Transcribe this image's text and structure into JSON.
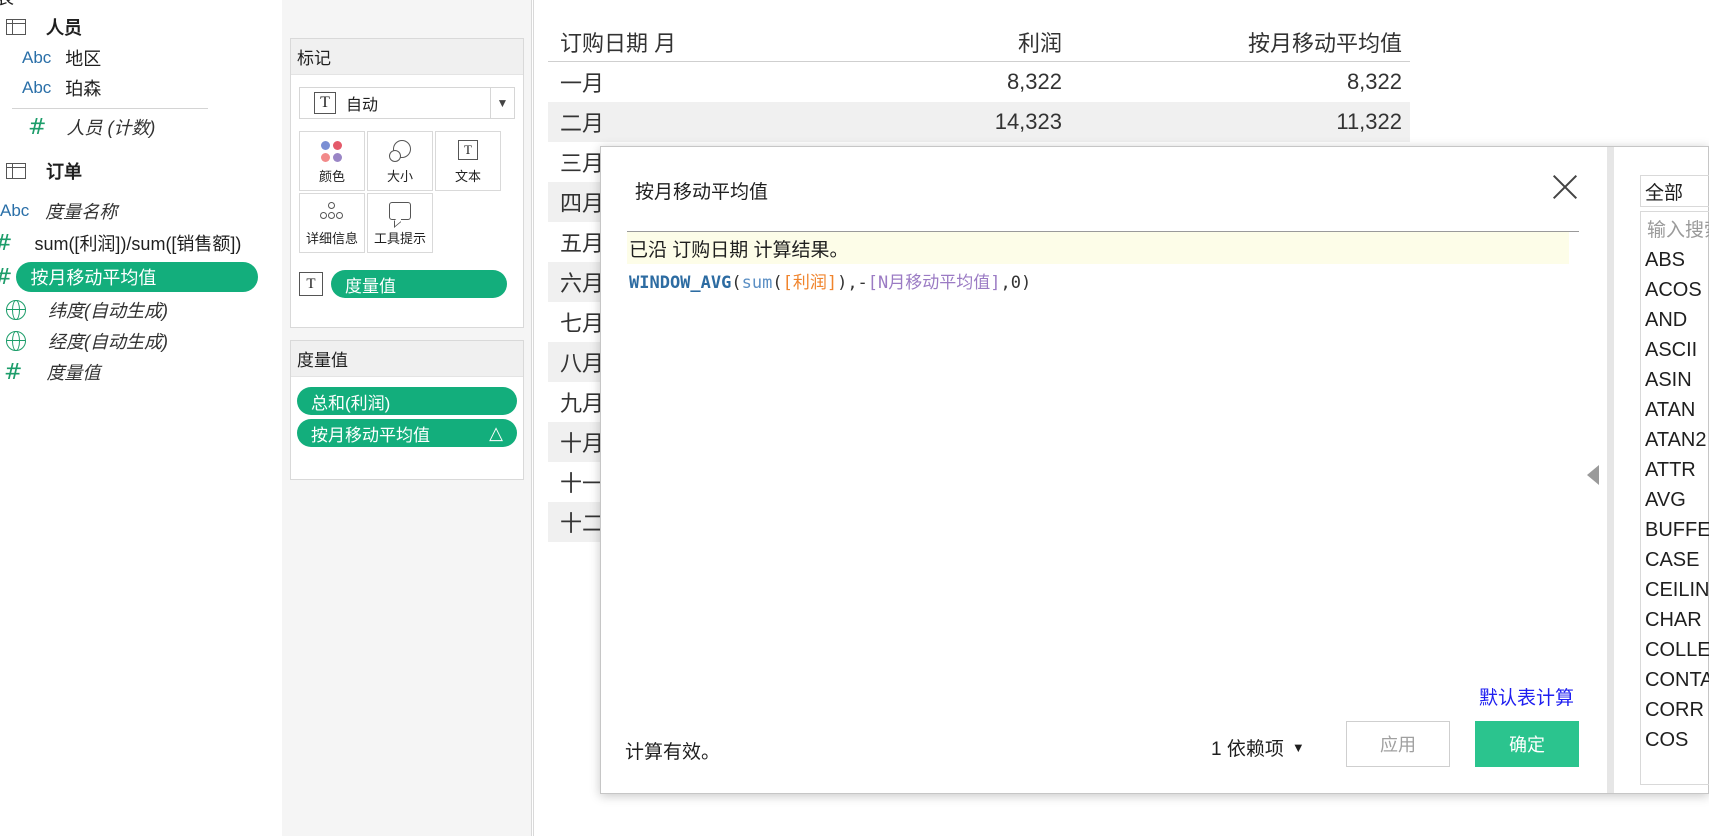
{
  "data_pane": {
    "top_partial": "表",
    "group_people": "人员",
    "field_region": "地区",
    "field_person": "珀森",
    "field_people_count": "人员 (计数)",
    "group_orders": "订单",
    "field_measure_names": "度量名称",
    "field_profit_ratio": "sum([利润])/sum([销售额])",
    "field_moving_avg": "按月移动平均值",
    "field_latitude": "纬度(自动生成)",
    "field_longitude": "经度(自动生成)",
    "field_measure_values": "度量值",
    "abc_label": "Abc",
    "hash_symbol": "#"
  },
  "marks": {
    "title": "标记",
    "type_value": "自动",
    "t_glyph": "T",
    "buttons": {
      "color": "颜色",
      "size": "大小",
      "text": "文本",
      "detail": "详细信息",
      "tooltip": "工具提示"
    },
    "text_pill": "度量值"
  },
  "measure_values_card": {
    "title": "度量值",
    "pills": [
      "总和(利润)",
      "按月移动平均值"
    ],
    "delta_symbol": "△"
  },
  "view_table": {
    "headers": [
      "订购日期 月",
      "利润",
      "按月移动平均值"
    ],
    "rows": [
      [
        "一月",
        "8,322",
        "8,322"
      ],
      [
        "二月",
        "14,323",
        "11,322"
      ],
      [
        "三月",
        "",
        ""
      ],
      [
        "四月",
        "",
        ""
      ],
      [
        "五月",
        "",
        ""
      ],
      [
        "六月",
        "",
        ""
      ],
      [
        "七月",
        "",
        ""
      ],
      [
        "八月",
        "",
        ""
      ],
      [
        "九月",
        "",
        ""
      ],
      [
        "十月",
        "",
        ""
      ],
      [
        "十一",
        "",
        ""
      ],
      [
        "十二",
        "",
        ""
      ]
    ]
  },
  "calc_dialog": {
    "title": "按月移动平均值",
    "note": "已沿 订购日期 计算结果。",
    "formula": {
      "fn": "WINDOW_AVG",
      "open": "(",
      "agg": "sum",
      "agg_open": "(",
      "field": "[利润]",
      "agg_close": ")",
      "comma1": ",-",
      "param": "[N月移动平均值]",
      "comma2": ",0",
      "close": ")"
    },
    "default_table_calc": "默认表计算",
    "status": "计算有效。",
    "dependencies": "1 依赖项",
    "apply": "应用",
    "ok": "确定"
  },
  "functions": {
    "filter_value": "全部",
    "search_placeholder": "输入搜索",
    "items": [
      "ABS",
      "ACOS",
      "AND",
      "ASCII",
      "ASIN",
      "ATAN",
      "ATAN2",
      "ATTR",
      "AVG",
      "BUFFER",
      "CASE",
      "CEILING",
      "CHAR",
      "COLLECT",
      "CONTAINS",
      "CORR",
      "COS"
    ]
  },
  "colors": {
    "pill_green": "#13ae7c",
    "ok_green": "#2bc48e",
    "link_blue": "#1f1ff0",
    "field_orange": "#f0842c",
    "param_purple": "#9b7bc4",
    "function_blue": "#2d6ca2"
  }
}
